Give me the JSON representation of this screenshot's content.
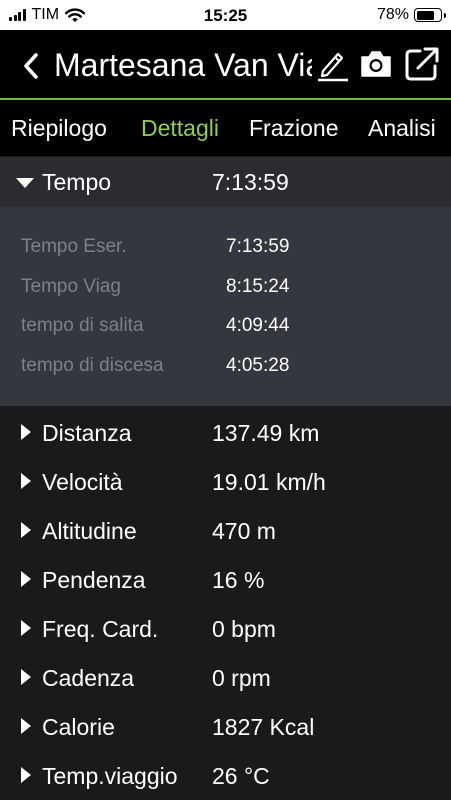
{
  "status_bar": {
    "carrier": "TIM",
    "time": "15:25",
    "battery": "78%",
    "battery_level": 0.78,
    "icons": [
      "signal-icon",
      "wifi-icon",
      "battery-icon"
    ]
  },
  "nav": {
    "title": "Martesana Van Viaggio",
    "icons": [
      "back-icon",
      "edit-icon",
      "camera-icon",
      "share-icon"
    ]
  },
  "tabs": [
    {
      "label": "Riepilogo",
      "active": false
    },
    {
      "label": "Dettagli",
      "active": true
    },
    {
      "label": "Frazione",
      "active": false
    },
    {
      "label": "Analisi",
      "active": false
    }
  ],
  "tempo": {
    "label": "Tempo",
    "value": "7:13:59",
    "details": [
      {
        "label": "Tempo Eser.",
        "value": "7:13:59"
      },
      {
        "label": "Tempo Viag",
        "value": "8:15:24"
      },
      {
        "label": "tempo di salita",
        "value": "4:09:44"
      },
      {
        "label": "tempo di discesa",
        "value": "4:05:28"
      }
    ]
  },
  "rows": [
    {
      "label": "Distanza",
      "value": "137.49 km"
    },
    {
      "label": "Velocità",
      "value": "19.01 km/h"
    },
    {
      "label": "Altitudine",
      "value": "470 m"
    },
    {
      "label": "Pendenza",
      "value": "16 %"
    },
    {
      "label": "Freq. Card.",
      "value": "0 bpm"
    },
    {
      "label": "Cadenza",
      "value": "0 rpm"
    },
    {
      "label": "Calorie",
      "value": "1827 Kcal"
    },
    {
      "label": "Temp.viaggio",
      "value": "26 °C"
    }
  ],
  "colors": {
    "accent": "#8ecf52",
    "nav_background": "#000000",
    "list_background": "#1a1a1c",
    "expanded_background": "#34373d"
  }
}
